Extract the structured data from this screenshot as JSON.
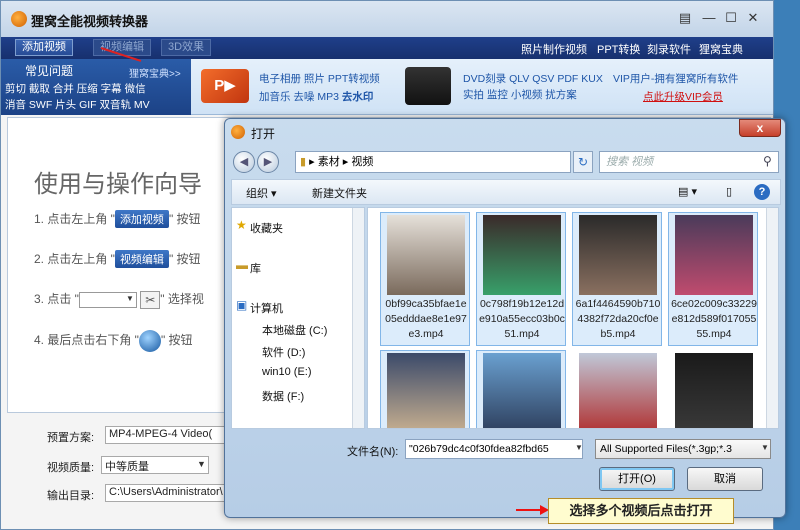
{
  "app": {
    "title": "狸窝全能视频转换器",
    "window_controls": [
      "▤",
      "—",
      "☐",
      "✕"
    ]
  },
  "navbar": {
    "buttons": [
      "添加视频",
      "视频编辑",
      "3D效果"
    ],
    "links": [
      "照片制作视频",
      "PPT转换",
      "刻录软件",
      "狸窝宝典"
    ]
  },
  "faq": {
    "title": "常见问题",
    "more": "狸窝宝典>>",
    "lines": [
      "剪切 截取 合并 压缩 字幕 微信",
      "消音 SWF 片头 GIF 双音轨 MV"
    ]
  },
  "promo": {
    "block1_line1": "电子相册 照片 PPT转视频",
    "block1_line2a": "加音乐 去噪 MP3 ",
    "block1_line2b": "去水印",
    "block2_line1": "DVD刻录 QLV QSV PDF KUX",
    "block2_line2": "实拍 监控 小视频 扰方案",
    "block3_line1": "VIP用户-拥有狸窝所有软件",
    "block3_line2": "点此升级VIP会员"
  },
  "guide": {
    "title": "使用与操作向导",
    "step1_prefix": "1. 点击左上角 \"",
    "step1_btn": "添加视频",
    "step1_suffix": "\" 按钮",
    "step2_prefix": "2. 点击左上角 \"",
    "step2_btn": "视频编辑",
    "step2_suffix": "\" 按钮",
    "step3_prefix": "3. 点击 \"",
    "step3_suffix": "\" 选择视",
    "step4_prefix": "4. 最后点击右下角 \"",
    "step4_suffix": "\" 按钮"
  },
  "bottom": {
    "preset_label": "预置方案:",
    "preset_value": "MP4-MPEG-4 Video(",
    "quality_label": "视频质量:",
    "quality_value": "中等质量",
    "output_label": "输出目录:",
    "output_value": "C:\\Users\\Administrator\\"
  },
  "dialog": {
    "title": "打开",
    "close": "x",
    "breadcrumb": [
      "素材",
      "视频"
    ],
    "search_placeholder": "搜索 视频",
    "toolbar": {
      "organize": "组织 ▾",
      "new_folder": "新建文件夹"
    },
    "sidebar": [
      "收藏夹",
      "库",
      "计算机",
      "本地磁盘 (C:)",
      "软件 (D:)",
      "win10 (E:)",
      "数据 (F:)"
    ],
    "files": [
      "0bf99ca35bfae1e05edddae8e1e97e3.mp4",
      "0c798f19b12e12de910a55ecc03b0c51.mp4",
      "6a1f4464590b7104382f72da20cf0eb5.mp4",
      "6ce02c009c33229e812d589f01705555.mp4",
      "",
      "",
      "",
      ""
    ],
    "filename_label": "文件名(N):",
    "filename_value": "\"026b79dc4c0f30fdea82fbd65",
    "filter_value": "All Supported Files(*.3gp;*.3",
    "open_button": "打开(O)",
    "cancel_button": "取消"
  },
  "hint": "选择多个视频后点击打开",
  "colors": {
    "accent": "#1f4f9c",
    "alert": "#e11111"
  }
}
